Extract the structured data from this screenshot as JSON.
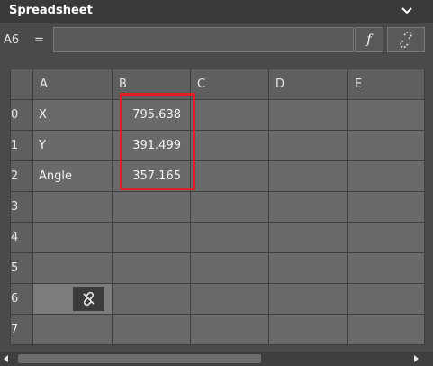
{
  "panel": {
    "title": "Spreadsheet",
    "collapse_icon": "chevron-down-icon"
  },
  "formula_bar": {
    "cell_ref": "A6",
    "equals": "=",
    "value": "",
    "function_label": "f",
    "link_icon": "unlink-icon"
  },
  "sheet": {
    "columns": [
      "A",
      "B",
      "C",
      "D",
      "E"
    ],
    "rows": [
      {
        "label": "0",
        "A": "X",
        "B": "795.638"
      },
      {
        "label": "1",
        "A": "Y",
        "B": "391.499"
      },
      {
        "label": "2",
        "A": "Angle",
        "B": "357.165"
      },
      {
        "label": "3",
        "A": "",
        "B": ""
      },
      {
        "label": "4",
        "A": "",
        "B": ""
      },
      {
        "label": "5",
        "A": "",
        "B": ""
      },
      {
        "label": "6",
        "A": "",
        "B": ""
      },
      {
        "label": "7",
        "A": "",
        "B": ""
      }
    ],
    "selected_cell": "A6",
    "highlight_color": "#e02020"
  }
}
